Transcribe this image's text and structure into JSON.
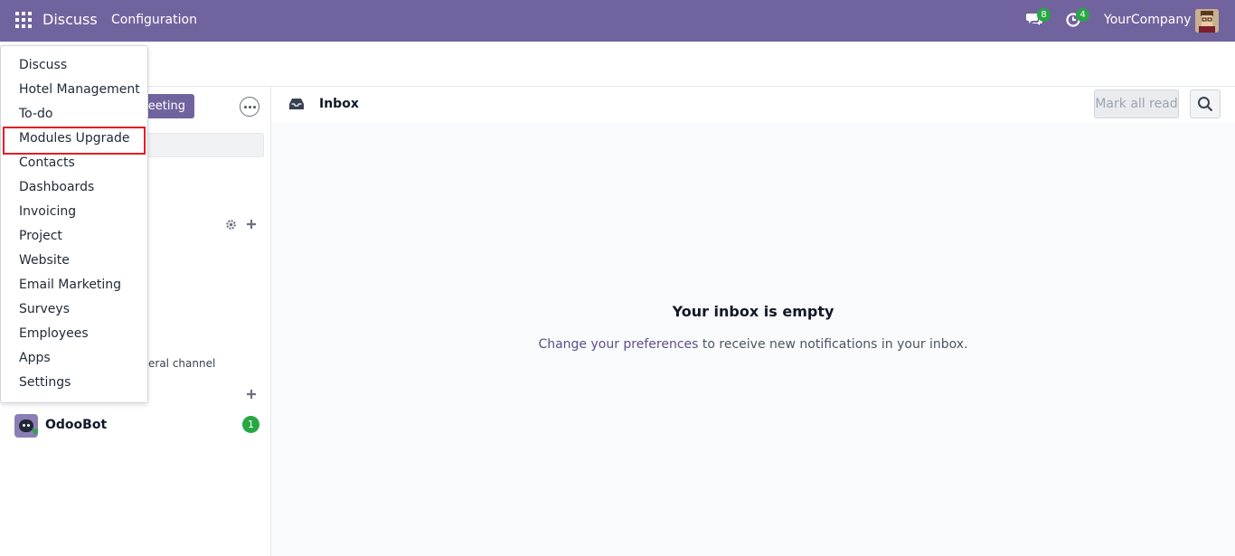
{
  "navbar": {
    "brand": "Discuss",
    "menu_configuration": "Configuration",
    "chat_count": "8",
    "activity_count": "4",
    "company": "YourCompany",
    "bg_color": "#71639e"
  },
  "apps_menu": {
    "items": [
      {
        "label": "Discuss"
      },
      {
        "label": "Hotel Management"
      },
      {
        "label": "To-do"
      },
      {
        "label": "Modules Upgrade",
        "highlighted": true
      },
      {
        "label": "Contacts"
      },
      {
        "label": "Dashboards"
      },
      {
        "label": "Invoicing"
      },
      {
        "label": "Project"
      },
      {
        "label": "Website"
      },
      {
        "label": "Email Marketing"
      },
      {
        "label": "Surveys"
      },
      {
        "label": "Employees"
      },
      {
        "label": "Apps"
      },
      {
        "label": "Settings"
      }
    ],
    "highlight_color": "#e41e25"
  },
  "sidebar": {
    "meeting_button_visible_text": "neeting",
    "general_channel_partial": "eral channel",
    "odoobot": {
      "name": "OdooBot",
      "unread": "1"
    }
  },
  "thread": {
    "title": "Inbox",
    "mark_all_read": "Mark all read",
    "empty_title": "Your inbox is empty",
    "empty_link": "Change your preferences",
    "empty_text": " to receive new notifications in your inbox."
  },
  "icons": {
    "apps": "grid-icon",
    "chat": "chat-icon",
    "activity": "clock-icon",
    "inbox": "inbox-icon",
    "search": "search-icon",
    "gear": "gear-icon",
    "plus": "plus-icon",
    "more": "ellipsis-icon"
  }
}
